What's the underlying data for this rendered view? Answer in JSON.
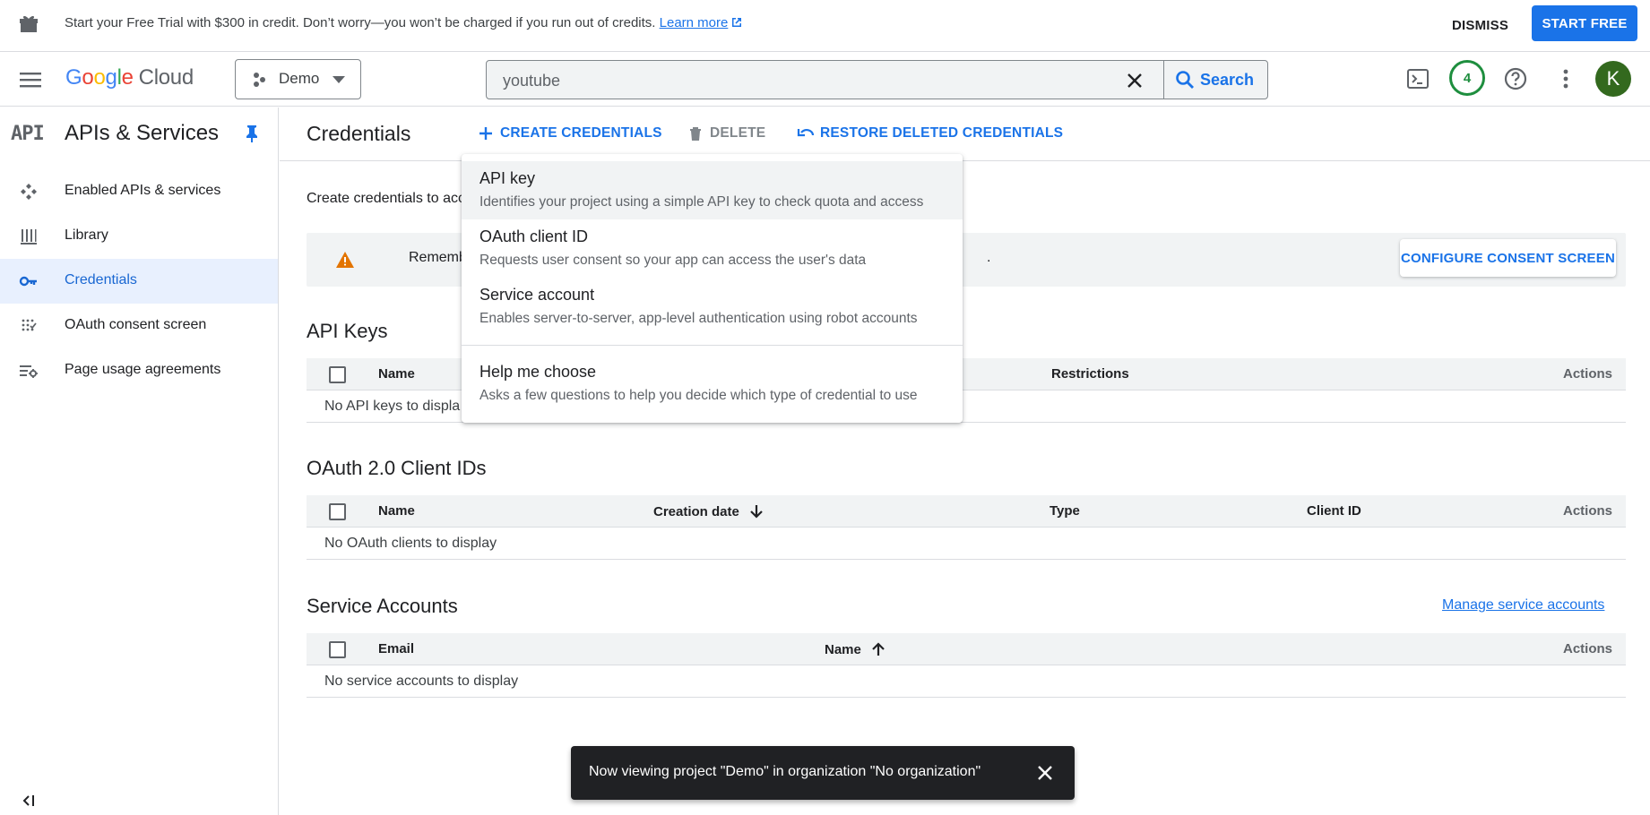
{
  "banner": {
    "message": "Start your Free Trial with $300 in credit. Don’t worry—you won’t be charged if you run out of credits.",
    "learn_more": "Learn more",
    "dismiss": "DISMISS",
    "start_free": "START FREE"
  },
  "topbar": {
    "logo_google": [
      "G",
      "o",
      "o",
      "g",
      "l",
      "e"
    ],
    "logo_cloud": "Cloud",
    "project": "Demo",
    "search_value": "youtube",
    "search_button": "Search",
    "notification_count": "4",
    "avatar_initial": "K"
  },
  "sidebar": {
    "api_badge": "API",
    "title": "APIs & Services",
    "items": [
      {
        "label": "Enabled APIs & services",
        "icon": "hub-icon"
      },
      {
        "label": "Library",
        "icon": "library-icon"
      },
      {
        "label": "Credentials",
        "icon": "key-icon",
        "active": true
      },
      {
        "label": "OAuth consent screen",
        "icon": "consent-icon"
      },
      {
        "label": "Page usage agreements",
        "icon": "settings-list-icon"
      }
    ]
  },
  "main": {
    "title": "Credentials",
    "actions": {
      "create": "CREATE CREDENTIALS",
      "delete": "DELETE",
      "restore": "RESTORE DELETED CREDENTIALS"
    },
    "intro": "Create credentials to acc",
    "warning_text": "Remember t",
    "warning_tail": ".",
    "configure_button": "CONFIGURE CONSENT SCREEN",
    "api_keys": {
      "title": "API Keys",
      "columns": [
        "Name",
        "Restrictions",
        "Actions"
      ],
      "empty": "No API keys to displa"
    },
    "oauth": {
      "title": "OAuth 2.0 Client IDs",
      "columns": [
        "Name",
        "Creation date",
        "Type",
        "Client ID",
        "Actions"
      ],
      "empty": "No OAuth clients to display"
    },
    "service_accounts": {
      "title": "Service Accounts",
      "manage_link": "Manage service accounts",
      "columns": [
        "Email",
        "Name",
        "Actions"
      ],
      "empty": "No service accounts to display"
    }
  },
  "menu": {
    "items": [
      {
        "title": "API key",
        "desc": "Identifies your project using a simple API key to check quota and access"
      },
      {
        "title": "OAuth client ID",
        "desc": "Requests user consent so your app can access the user's data"
      },
      {
        "title": "Service account",
        "desc": "Enables server-to-server, app-level authentication using robot accounts"
      },
      {
        "title": "Help me choose",
        "desc": "Asks a few questions to help you decide which type of credential to use"
      }
    ]
  },
  "snackbar": {
    "text": "Now viewing project \"Demo\" in organization \"No organization\""
  },
  "colors": {
    "accent": "#1a73e8",
    "active_bg": "#e8f0fe",
    "warning": "#e37400",
    "badge_green": "#1e8e3e",
    "avatar": "#33691e"
  }
}
